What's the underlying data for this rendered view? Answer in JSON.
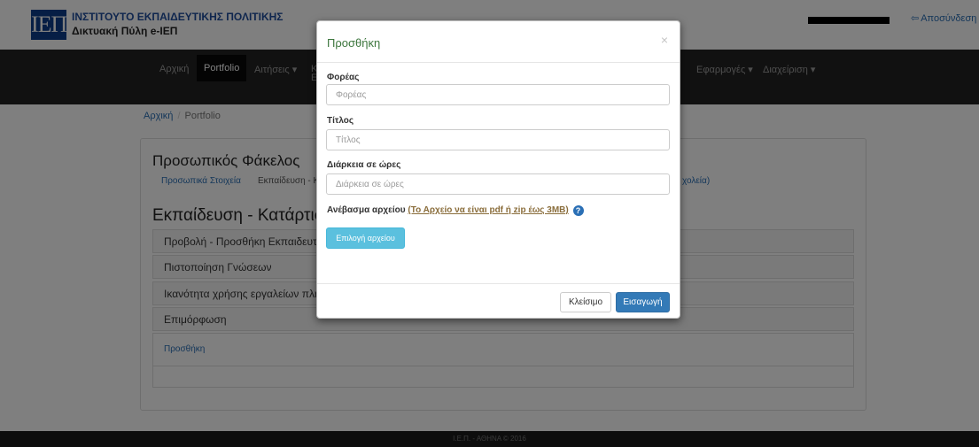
{
  "header": {
    "logo_text": "ΙΕΠ",
    "org_name": "ΙΝΣΤΙΤΟΥΤΟ ΕΚΠΑΙΔΕΥΤΙΚΗΣ ΠΟΛΙΤΙΚΗΣ",
    "portal_name": "Δικτυακή Πύλη e-ΙΕΠ",
    "logout_icon": "logout-icon",
    "logout_label": "Αποσύνδεση"
  },
  "nav": {
    "home": "Αρχική",
    "portfolio": "Portfolio",
    "applications": "Αιτήσεις ▾",
    "applications_partial": "Κ",
    "applications_partial_2": "Ε",
    "apps": "Εφαρμογές ▾",
    "admin": "Διαχείριση ▾"
  },
  "breadcrumb": {
    "home": "Αρχική",
    "separator": "/",
    "current": "Portfolio"
  },
  "panel": {
    "title": "Προσωπικός Φάκελος",
    "tabs": {
      "personal": "Προσωπικά Στοιχεία",
      "education": "Εκπαίδευση - Κ",
      "right_fragment": "χολεία)"
    },
    "section_title": "Εκπαίδευση - Κατάρτιση",
    "rows": [
      "Προβολή - Προσθήκη Εκπαιδευτική",
      "Πιστοποίηση Γνώσεων",
      "Ικανότητα χρήσης εργαλείων πληρο",
      "Επιμόρφωση"
    ],
    "add_link": "Προσθήκη"
  },
  "footer": {
    "text": "Ι.Ε.Π. - ΑΘΗΝΑ © 2016"
  },
  "modal": {
    "title": "Προσθήκη",
    "close_symbol": "×",
    "fields": {
      "provider_label": "Φορέας",
      "provider_placeholder": "Φορέας",
      "title_label": "Τίτλος",
      "title_placeholder": "Τίτλος",
      "duration_label": "Διάρκεια σε ώρες",
      "duration_placeholder": "Διάρκεια σε ώρες"
    },
    "upload": {
      "label": "Ανέβασμα αρχείου",
      "note": "(Το Αρχείο να είναι pdf ή zip έως 3MB)",
      "help_icon": "question-circle-icon",
      "help_symbol": "?",
      "choose_button": "Επιλογή αρχείου"
    },
    "close_button": "Κλείσιμο",
    "submit_button": "Εισαγωγή"
  }
}
